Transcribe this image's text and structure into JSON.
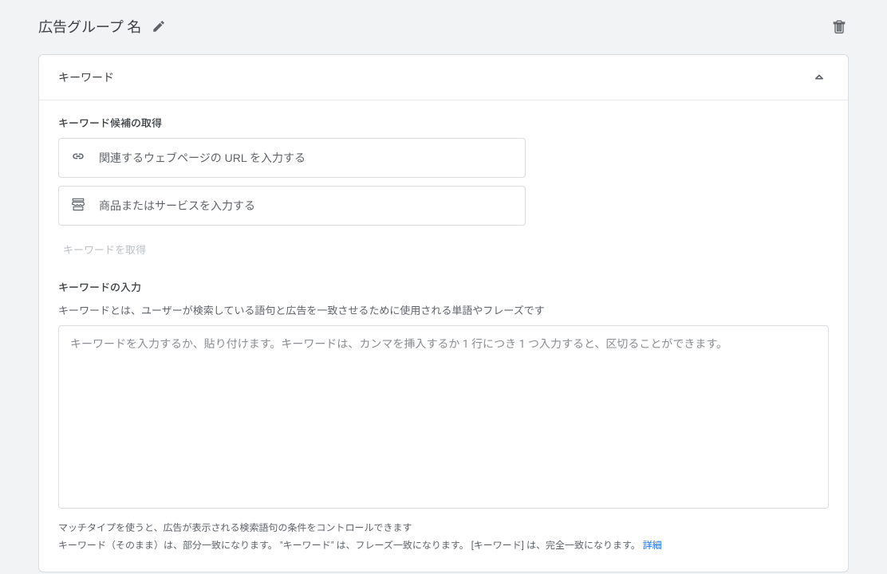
{
  "header": {
    "title": "広告グループ 名"
  },
  "card": {
    "title": "キーワード",
    "suggest": {
      "section_label": "キーワード候補の取得",
      "url_placeholder": "関連するウェブページの URL を入力する",
      "product_placeholder": "商品またはサービスを入力する",
      "get_button": "キーワードを取得"
    },
    "entry": {
      "section_label": "キーワードの入力",
      "description": "キーワードとは、ユーザーが検索している語句と広告を一致させるために使用される単語やフレーズです",
      "textarea_placeholder": "キーワードを入力するか、貼り付けます。キーワードは、カンマを挿入するか 1 行につき 1 つ入力すると、区切ることができます。"
    },
    "footnote": {
      "line1": "マッチタイプを使うと、広告が表示される検索語句の条件をコントロールできます",
      "line2": "キーワード（そのまま）は、部分一致になります。  \"キーワード\" は、フレーズ一致になります。  [キーワード] は、完全一致になります。 ",
      "link": "詳細"
    }
  }
}
